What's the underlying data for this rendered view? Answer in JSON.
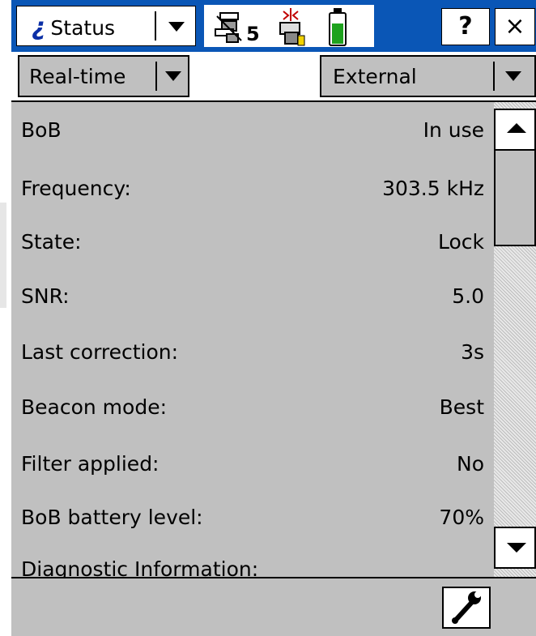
{
  "title_bar": {
    "app_label": "Status",
    "satellite_count": "5",
    "help_label": "?",
    "close_label": "×",
    "icons": [
      "info-icon",
      "satellite-icon",
      "radio-icon",
      "battery-icon"
    ]
  },
  "toolbar": {
    "mode_label": "Real-time",
    "source_label": "External"
  },
  "rows": [
    {
      "label": "BoB",
      "value": "In use"
    },
    {
      "label": "Frequency:",
      "value": "303.5 kHz"
    },
    {
      "label": "State:",
      "value": "Lock"
    },
    {
      "label": "SNR:",
      "value": "5.0"
    },
    {
      "label": "Last correction:",
      "value": "3s"
    },
    {
      "label": "Beacon mode:",
      "value": "Best"
    },
    {
      "label": "Filter applied:",
      "value": "No"
    },
    {
      "label": "BoB battery level:",
      "value": "70%"
    },
    {
      "label": "Diagnostic Information:",
      "value": ""
    }
  ],
  "bottom_bar": {
    "icon": "wrench-icon"
  },
  "colors": {
    "title_bar": "#0a56b6",
    "panel": "#c0c0c0",
    "battery_fill": "#1ea21e"
  },
  "battery_level": 0.7
}
